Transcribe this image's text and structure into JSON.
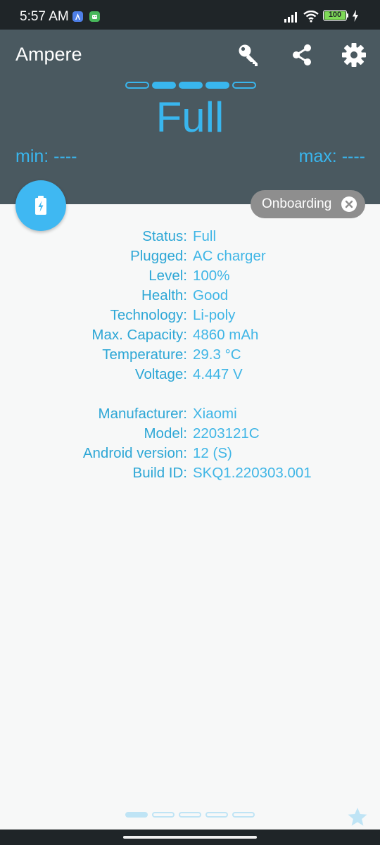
{
  "status_bar": {
    "time": "5:57 AM",
    "battery_percent": "100",
    "signal_icon": "signal-icon",
    "wifi_icon": "wifi-icon",
    "charging_icon": "charging-bolt-icon"
  },
  "header": {
    "title": "Ampere",
    "icons": [
      "key-icon",
      "share-icon",
      "settings-gear-icon"
    ],
    "level_segments_total": 5,
    "level_segments_filled": 3,
    "status": "Full",
    "min_label": "min: ----",
    "max_label": "max: ----"
  },
  "fab": {
    "icon": "battery-charging-icon"
  },
  "chip": {
    "label": "Onboarding",
    "close_icon": "close-icon"
  },
  "info": {
    "status": {
      "label": "Status:",
      "value": "Full"
    },
    "plugged": {
      "label": "Plugged:",
      "value": "AC charger"
    },
    "level": {
      "label": "Level:",
      "value": "100%"
    },
    "health": {
      "label": "Health:",
      "value": "Good"
    },
    "technology": {
      "label": "Technology:",
      "value": "Li-poly"
    },
    "capacity": {
      "label": "Max. Capacity:",
      "value": "4860 mAh"
    },
    "temperature": {
      "label": "Temperature:",
      "value": "29.3 °C"
    },
    "voltage": {
      "label": "Voltage:",
      "value": "4.447 V"
    },
    "manufacturer": {
      "label": "Manufacturer:",
      "value": "Xiaomi"
    },
    "model": {
      "label": "Model:",
      "value": "2203121C"
    },
    "android": {
      "label": "Android version:",
      "value": "12 (S)"
    },
    "build": {
      "label": "Build ID:",
      "value": "SKQ1.220303.001"
    }
  },
  "pager": {
    "pages_total": 5,
    "current_page": 1,
    "star_icon": "star-icon"
  },
  "colors": {
    "accent": "#39b6ee",
    "header_bg": "#4a5960",
    "status_bar_bg": "#1f2528",
    "content_bg": "#f7f8f8",
    "chip_bg": "#8e8e8e"
  }
}
